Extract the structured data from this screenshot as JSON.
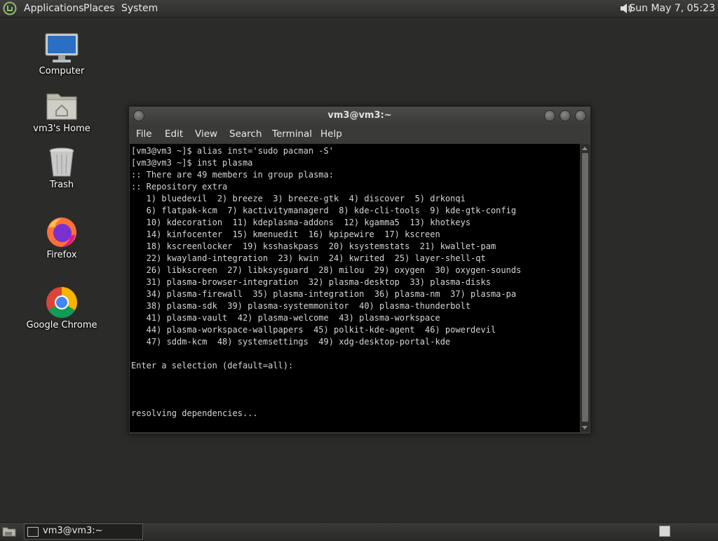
{
  "top_panel": {
    "menus": [
      "Applications",
      "Places",
      "System"
    ],
    "clock": "Sun May  7, 05:23",
    "logo_icon": "mint-logo-icon",
    "volume_icon": "speaker-icon"
  },
  "desktop_icons": [
    {
      "label": "Computer",
      "icon": "computer-icon"
    },
    {
      "label": "vm3's Home",
      "icon": "home-folder-icon"
    },
    {
      "label": "Trash",
      "icon": "trash-icon"
    },
    {
      "label": "Firefox",
      "icon": "firefox-icon"
    },
    {
      "label": "Google Chrome",
      "icon": "chrome-icon"
    }
  ],
  "window": {
    "title": "vm3@vm3:~",
    "menu": [
      "File",
      "Edit",
      "View",
      "Search",
      "Terminal",
      "Help"
    ],
    "terminal_lines": [
      "[vm3@vm3 ~]$ alias inst='sudo pacman -S'",
      "[vm3@vm3 ~]$ inst plasma",
      ":: There are 49 members in group plasma:",
      ":: Repository extra",
      "   1) bluedevil  2) breeze  3) breeze-gtk  4) discover  5) drkonqi",
      "   6) flatpak-kcm  7) kactivitymanagerd  8) kde-cli-tools  9) kde-gtk-config",
      "   10) kdecoration  11) kdeplasma-addons  12) kgamma5  13) khotkeys",
      "   14) kinfocenter  15) kmenuedit  16) kpipewire  17) kscreen",
      "   18) kscreenlocker  19) ksshaskpass  20) ksystemstats  21) kwallet-pam",
      "   22) kwayland-integration  23) kwin  24) kwrited  25) layer-shell-qt",
      "   26) libkscreen  27) libksysguard  28) milou  29) oxygen  30) oxygen-sounds",
      "   31) plasma-browser-integration  32) plasma-desktop  33) plasma-disks",
      "   34) plasma-firewall  35) plasma-integration  36) plasma-nm  37) plasma-pa",
      "   38) plasma-sdk  39) plasma-systemmonitor  40) plasma-thunderbolt",
      "   41) plasma-vault  42) plasma-welcome  43) plasma-workspace",
      "   44) plasma-workspace-wallpapers  45) polkit-kde-agent  46) powerdevil",
      "   47) sddm-kcm  48) systemsettings  49) xdg-desktop-portal-kde",
      "",
      "Enter a selection (default=all):",
      "",
      "",
      "",
      "resolving dependencies..."
    ]
  },
  "taskbar": {
    "task_label": "vm3@vm3:~",
    "show_desktop_icon": "show-desktop-icon",
    "workspace_icon": "workspace-switcher-icon"
  }
}
